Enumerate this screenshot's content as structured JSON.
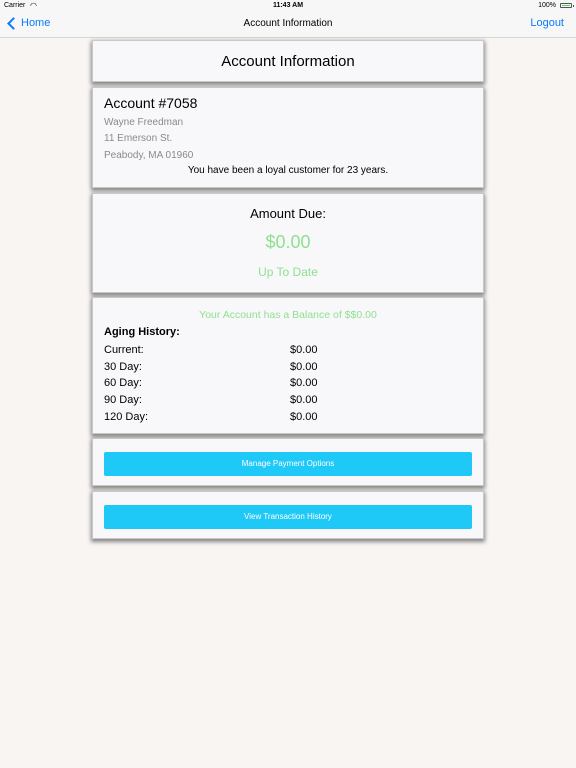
{
  "status_bar": {
    "carrier": "Carrier",
    "time": "11:43 AM",
    "battery": "100%"
  },
  "nav": {
    "back_label": "Home",
    "title": "Account Information",
    "logout_label": "Logout"
  },
  "header": {
    "title": "Account Information"
  },
  "account": {
    "number": "Account #7058",
    "name": "Wayne Freedman",
    "street": "11 Emerson St.",
    "city": "Peabody, MA 01960",
    "loyalty": "You have been a loyal customer for 23 years."
  },
  "amount": {
    "label": "Amount Due:",
    "value": "$0.00",
    "status": "Up To Date"
  },
  "aging": {
    "balance_message": "Your Account has a Balance of $$0.00",
    "title": "Aging History:",
    "rows": [
      {
        "label": "Current:",
        "value": "$0.00"
      },
      {
        "label": "30 Day:",
        "value": "$0.00"
      },
      {
        "label": "60 Day:",
        "value": "$0.00"
      },
      {
        "label": "90 Day:",
        "value": "$0.00"
      },
      {
        "label": "120 Day:",
        "value": "$0.00"
      }
    ]
  },
  "buttons": {
    "manage_payment": "Manage Payment Options",
    "view_history": "View Transaction History"
  },
  "colors": {
    "accent": "#0a7aff",
    "button": "#1ec8f7",
    "positive": "#8fe08f"
  }
}
